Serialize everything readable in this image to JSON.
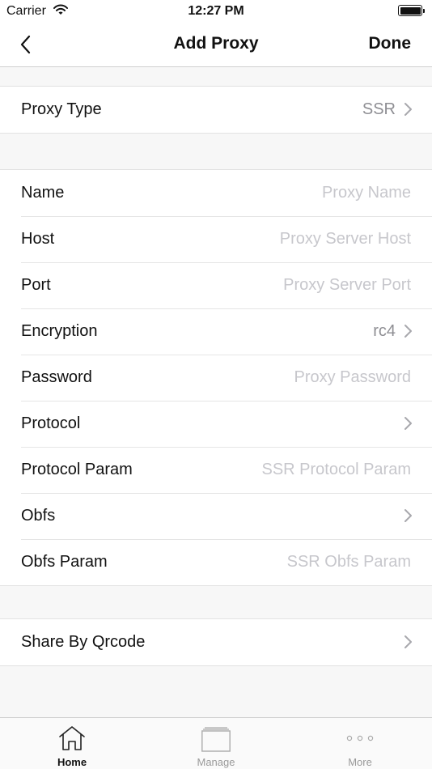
{
  "status_bar": {
    "carrier": "Carrier",
    "time": "12:27 PM",
    "wifi_icon": "wifi-icon",
    "battery_icon": "battery-icon"
  },
  "nav": {
    "back_icon": "chevron-left-icon",
    "title": "Add Proxy",
    "done_label": "Done"
  },
  "proxy_type": {
    "label": "Proxy Type",
    "value": "SSR"
  },
  "fields": {
    "name": {
      "label": "Name",
      "placeholder": "Proxy Name",
      "value": ""
    },
    "host": {
      "label": "Host",
      "placeholder": "Proxy Server Host",
      "value": ""
    },
    "port": {
      "label": "Port",
      "placeholder": "Proxy Server Port",
      "value": ""
    },
    "encryption": {
      "label": "Encryption",
      "value": "rc4"
    },
    "password": {
      "label": "Password",
      "placeholder": "Proxy Password",
      "value": ""
    },
    "protocol": {
      "label": "Protocol",
      "value": ""
    },
    "protocol_param": {
      "label": "Protocol Param",
      "placeholder": "SSR Protocol Param",
      "value": ""
    },
    "obfs": {
      "label": "Obfs",
      "value": ""
    },
    "obfs_param": {
      "label": "Obfs Param",
      "placeholder": "SSR Obfs Param",
      "value": ""
    }
  },
  "share": {
    "label": "Share By Qrcode"
  },
  "tab_bar": {
    "tabs": [
      {
        "label": "Home",
        "icon": "home-icon",
        "active": true
      },
      {
        "label": "Manage",
        "icon": "stack-icon",
        "active": false
      },
      {
        "label": "More",
        "icon": "more-dots-icon",
        "active": false
      }
    ]
  },
  "colors": {
    "accent": "#111111",
    "placeholder": "#c7c7cc",
    "secondary_text": "#8e8e93",
    "background": "#f7f7f7",
    "tab_inactive": "#9a9a9a"
  }
}
